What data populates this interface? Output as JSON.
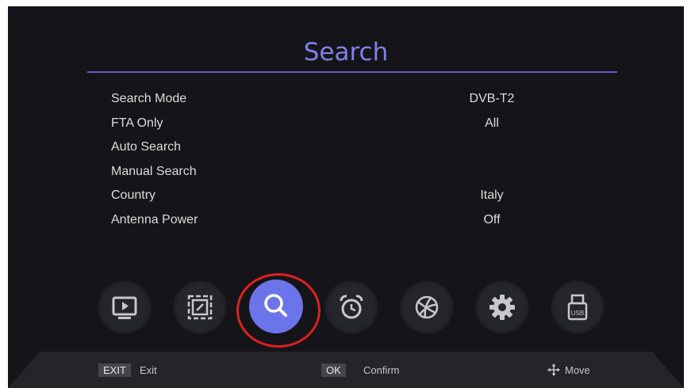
{
  "header": {
    "title": "Search"
  },
  "menu": [
    {
      "label": "Search Mode",
      "value": "DVB-T2"
    },
    {
      "label": "FTA Only",
      "value": "All"
    },
    {
      "label": "Auto Search",
      "value": ""
    },
    {
      "label": "Manual Search",
      "value": ""
    },
    {
      "label": "Country",
      "value": "Italy"
    },
    {
      "label": "Antenna Power",
      "value": "Off"
    }
  ],
  "icons": [
    {
      "name": "tv-icon",
      "active": false
    },
    {
      "name": "picture-icon",
      "active": false
    },
    {
      "name": "search-icon",
      "active": true
    },
    {
      "name": "alarm-clock-icon",
      "active": false
    },
    {
      "name": "network-globe-icon",
      "active": false
    },
    {
      "name": "gear-icon",
      "active": false
    },
    {
      "name": "usb-icon",
      "active": false,
      "text": "USB"
    }
  ],
  "footer": {
    "exit_key": "EXIT",
    "exit_label": "Exit",
    "ok_key": "OK",
    "ok_label": "Confirm",
    "move_icon": "move-arrows-icon",
    "move_label": "Move"
  },
  "colors": {
    "accent": "#8080e6",
    "active": "#6c74ea",
    "highlight_ring": "#dd2020",
    "background": "#151519"
  }
}
